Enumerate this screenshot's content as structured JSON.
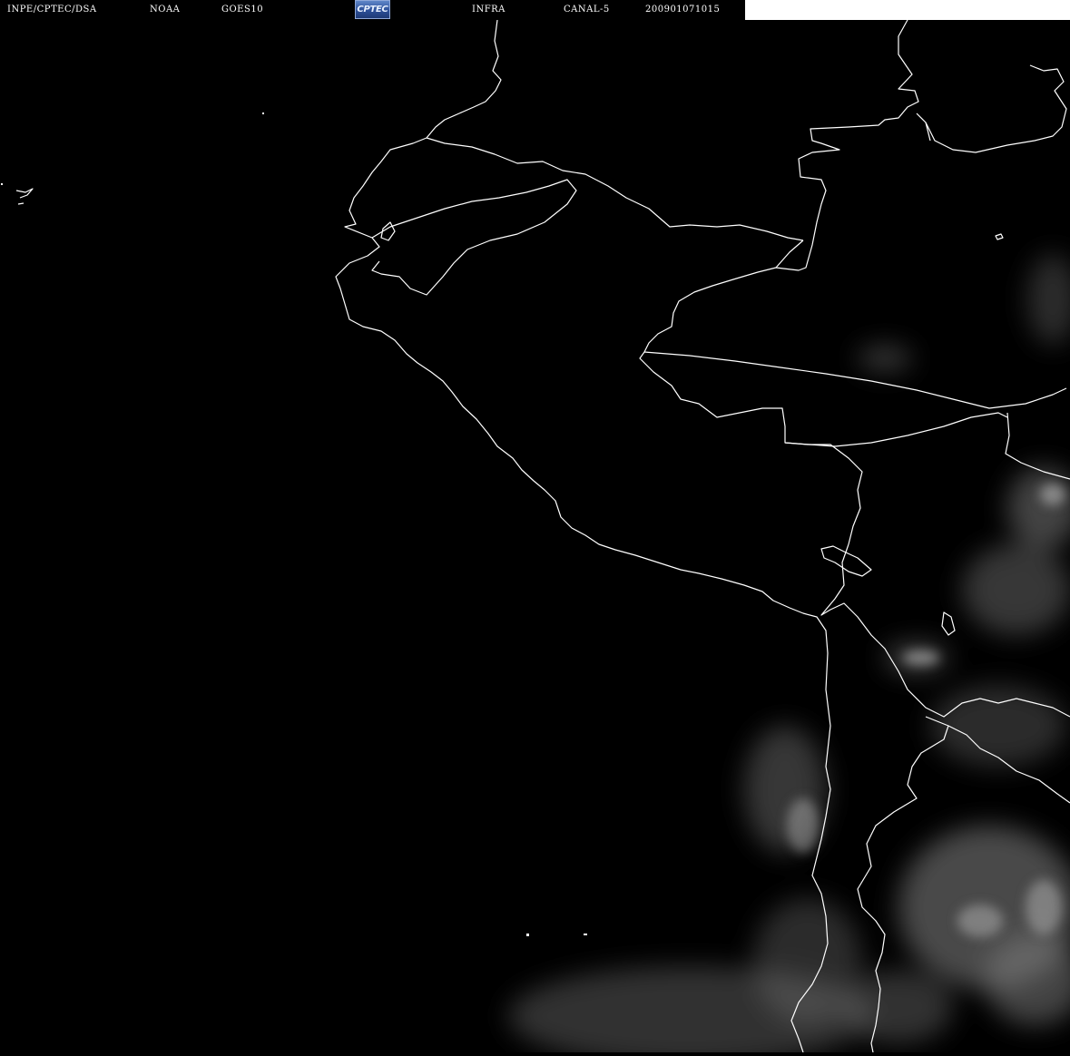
{
  "header": {
    "institution": "INPE/CPTEC/DSA",
    "agency": "NOAA",
    "satellite": "GOES10",
    "logo_text": "CPTEC",
    "band": "INFRA",
    "channel": "CANAL-5",
    "timestamp": "200901071015"
  },
  "map": {
    "background_color": "#000000",
    "coastline_color": "#ffffff",
    "cloud_color": "#9a9a9a"
  }
}
